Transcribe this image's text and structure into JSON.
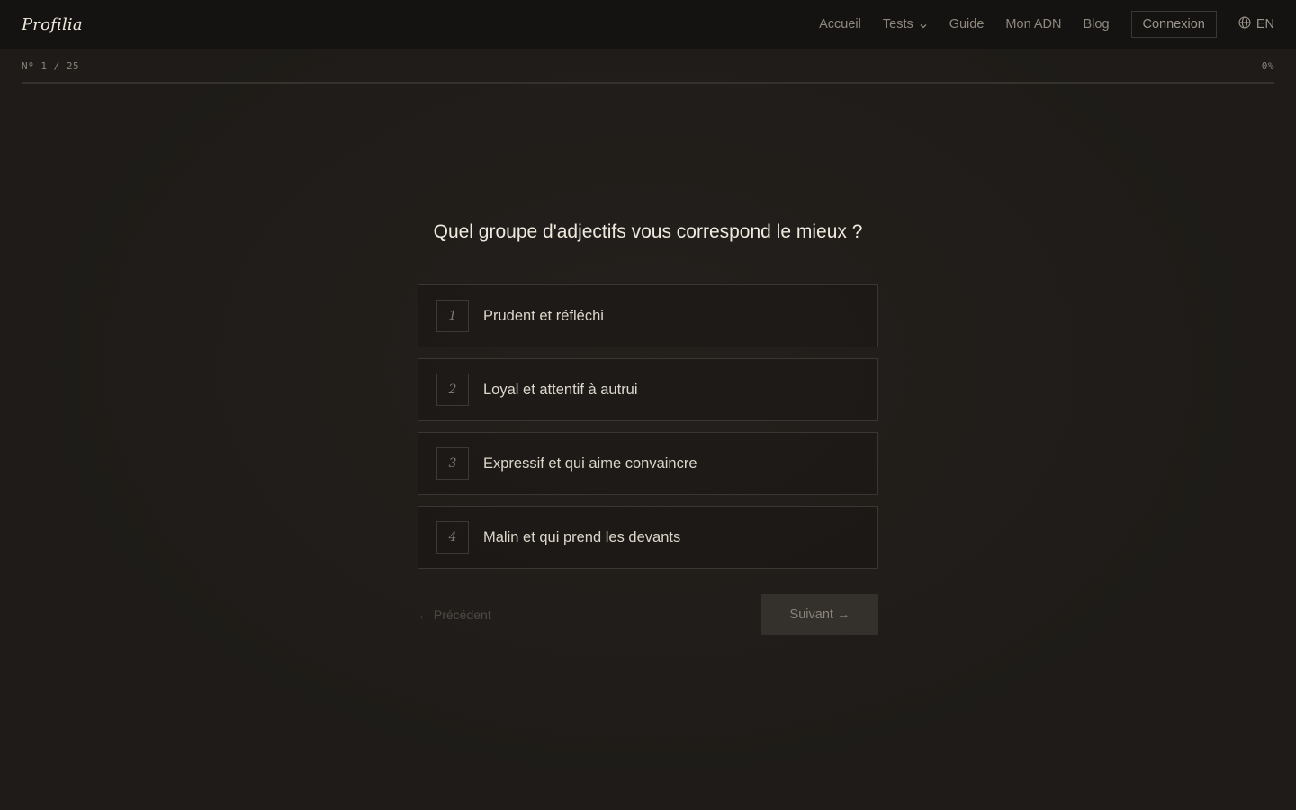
{
  "header": {
    "brand": "Profilia",
    "nav": {
      "home": "Accueil",
      "tests": "Tests",
      "guide": "Guide",
      "dna": "Mon ADN",
      "blog": "Blog"
    },
    "login_label": "Connexion",
    "language": "EN",
    "icons": {
      "tests_dropdown": "chevron-down-icon",
      "language": "globe-icon"
    }
  },
  "progress": {
    "counter": "Nº 1 / 25",
    "percent_label": "0%",
    "value": 0
  },
  "question": {
    "text": "Quel groupe d'adjectifs vous correspond le mieux ?",
    "options": [
      {
        "number": "1",
        "label": "Prudent et réfléchi"
      },
      {
        "number": "2",
        "label": "Loyal et attentif à autrui"
      },
      {
        "number": "3",
        "label": "Expressif et qui aime convaincre"
      },
      {
        "number": "4",
        "label": "Malin et qui prend les devants"
      }
    ]
  },
  "actions": {
    "previous_label": "← Précédent",
    "next_label": "Suivant →"
  },
  "colors": {
    "background": "#1e1b18",
    "header": "#141312",
    "border": "#3a3631",
    "accent": "#c9a86a"
  }
}
